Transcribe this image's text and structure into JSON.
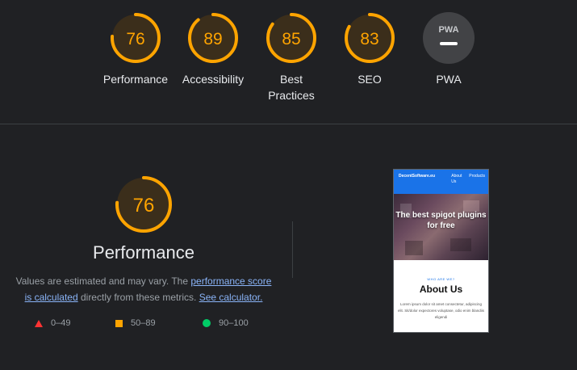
{
  "summary": {
    "gauges": [
      {
        "label": "Performance",
        "score": "76",
        "fraction": 0.76,
        "color": "#ffa400"
      },
      {
        "label": "Accessibility",
        "score": "89",
        "fraction": 0.89,
        "color": "#ffa400"
      },
      {
        "label": "Best Practices",
        "score": "85",
        "fraction": 0.85,
        "color": "#ffa400"
      },
      {
        "label": "SEO",
        "score": "83",
        "fraction": 0.83,
        "color": "#ffa400"
      },
      {
        "label": "PWA",
        "badge_text": "PWA",
        "color": "#5f6368"
      }
    ]
  },
  "detail": {
    "score": "76",
    "fraction": 0.76,
    "title": "Performance",
    "desc_before": "Values are estimated and may vary. The ",
    "desc_link1": "performance score is calculated",
    "desc_middle": " directly from these metrics. ",
    "desc_link2": "See calculator.",
    "legend": [
      {
        "shape": "triangle",
        "range": "0–49",
        "color": "#ff3333"
      },
      {
        "shape": "square",
        "range": "50–89",
        "color": "#ffa400"
      },
      {
        "shape": "circle",
        "range": "90–100",
        "color": "#00cc66"
      }
    ]
  },
  "thumbnail": {
    "brand": "DecentSoftware.eu",
    "nav1": "About Us",
    "nav2": "Products",
    "hero_heading": "The best spigot plugins for free",
    "kicker": "WHO ARE WE?",
    "about_title": "About Us",
    "lorem": "Lorem ipsum dolor sit amet consectetur, adipiscing elit. Sit/dolor expectores voluptase, odio enim blandiis eligendi"
  },
  "colors": {
    "background": "#202124",
    "medium": "#ffa400",
    "text": "#e8eaed",
    "link": "#8ab4f8"
  }
}
